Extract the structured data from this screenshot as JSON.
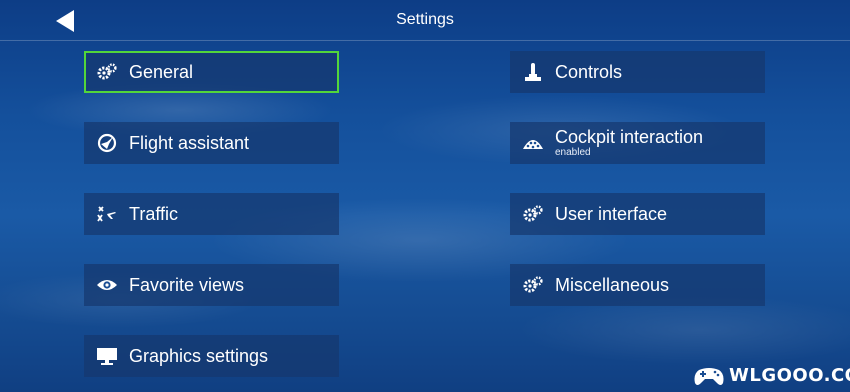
{
  "header": {
    "title": "Settings",
    "back_icon": "back-arrow-icon"
  },
  "menu": {
    "selected": "General",
    "items": [
      {
        "label": "General",
        "icon": "gear-icon",
        "sub": ""
      },
      {
        "label": "Flight assistant",
        "icon": "flight-assist-icon",
        "sub": ""
      },
      {
        "label": "Traffic",
        "icon": "traffic-planes-icon",
        "sub": ""
      },
      {
        "label": "Favorite views",
        "icon": "eye-icon",
        "sub": ""
      },
      {
        "label": "Graphics settings",
        "icon": "monitor-icon",
        "sub": ""
      },
      {
        "label": "Controls",
        "icon": "joystick-icon",
        "sub": ""
      },
      {
        "label": "Cockpit interaction",
        "icon": "cockpit-icon",
        "sub": "enabled"
      },
      {
        "label": "User interface",
        "icon": "gear-icon",
        "sub": ""
      },
      {
        "label": "Miscellaneous",
        "icon": "gear-icon",
        "sub": ""
      }
    ]
  },
  "watermark": {
    "text": "WLGOOO.COM",
    "icon": "gamepad-icon"
  },
  "colors": {
    "selected_border": "#53d63a",
    "button_bg": "rgba(22,56,110,0.70)",
    "text": "#ffffff"
  }
}
